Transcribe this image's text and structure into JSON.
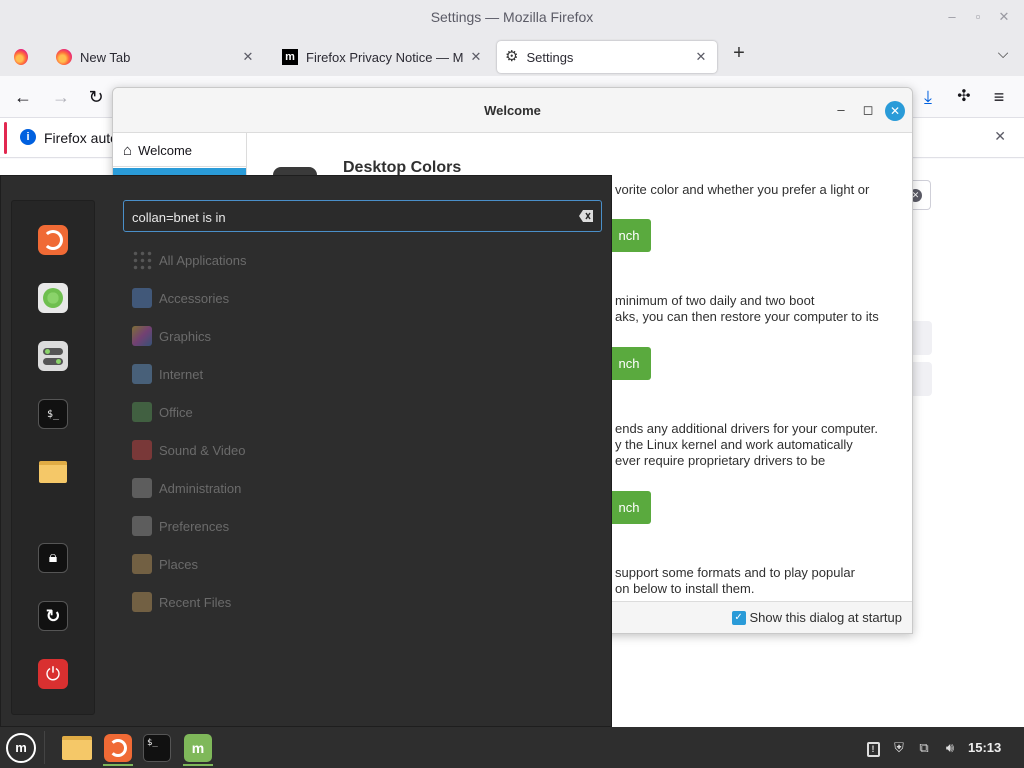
{
  "firefox": {
    "window_title": "Settings — Mozilla Firefox",
    "tabs": [
      {
        "label": "New Tab"
      },
      {
        "label": "Firefox Privacy Notice — M"
      },
      {
        "label": "Settings"
      }
    ],
    "new_tab_symbol": "+",
    "infobar_text": "Firefox auto"
  },
  "welcome_dialog": {
    "title": "Welcome",
    "sidebar_item": "Welcome",
    "section_title": "Desktop Colors",
    "desc1": "vorite color and whether you prefer a light or",
    "launch1": "nch",
    "desc2_line1": "minimum of two daily and two boot",
    "desc2_line2": "aks, you can then restore your computer to its",
    "launch2": "nch",
    "desc3_line1": "ends any additional drivers for your computer.",
    "desc3_line2": "y the Linux kernel and work automatically",
    "desc3_line3": "ever require proprietary drivers to be",
    "launch3": "nch",
    "desc4_line1": "support some formats and to play popular",
    "desc4_line2": "on below to install them.",
    "startup_label": "Show this dialog at startup",
    "startup_checked": true
  },
  "menu": {
    "search_value": "collan=bnet is in",
    "favorites": [
      {
        "name": "Firefox",
        "icon": "firefox-icon"
      },
      {
        "name": "Software Manager",
        "icon": "software-manager-icon"
      },
      {
        "name": "System Settings",
        "icon": "settings-toggle-icon"
      },
      {
        "name": "Terminal",
        "icon": "terminal-icon"
      },
      {
        "name": "Files",
        "icon": "folder-icon"
      },
      {
        "name": "Lock Screen",
        "icon": "lock-icon"
      },
      {
        "name": "Log Out",
        "icon": "logout-icon"
      },
      {
        "name": "Quit",
        "icon": "power-icon"
      }
    ],
    "categories": [
      {
        "label": "All Applications",
        "color": "#888888"
      },
      {
        "label": "Accessories",
        "color": "#5b8fd6"
      },
      {
        "label": "Graphics",
        "color": "#c858c8"
      },
      {
        "label": "Internet",
        "color": "#6aa0d8"
      },
      {
        "label": "Office",
        "color": "#5aa05a"
      },
      {
        "label": "Sound & Video",
        "color": "#d84848"
      },
      {
        "label": "Administration",
        "color": "#999999"
      },
      {
        "label": "Preferences",
        "color": "#999999"
      },
      {
        "label": "Places",
        "color": "#c8a060"
      },
      {
        "label": "Recent Files",
        "color": "#c8a060"
      }
    ]
  },
  "taskbar": {
    "clock": "15:13",
    "apps": [
      {
        "name": "Files",
        "icon": "folder-icon"
      },
      {
        "name": "Firefox",
        "icon": "firefox-icon"
      },
      {
        "name": "Terminal",
        "icon": "terminal-icon"
      },
      {
        "name": "Welcome Screen",
        "icon": "mint-welcome-icon"
      }
    ]
  },
  "colors": {
    "mint_green": "#5aaa3e",
    "accent_blue": "#2a9bd8",
    "menu_bg": "#2d2d2d",
    "taskbar_bg": "#2e2e2e"
  }
}
